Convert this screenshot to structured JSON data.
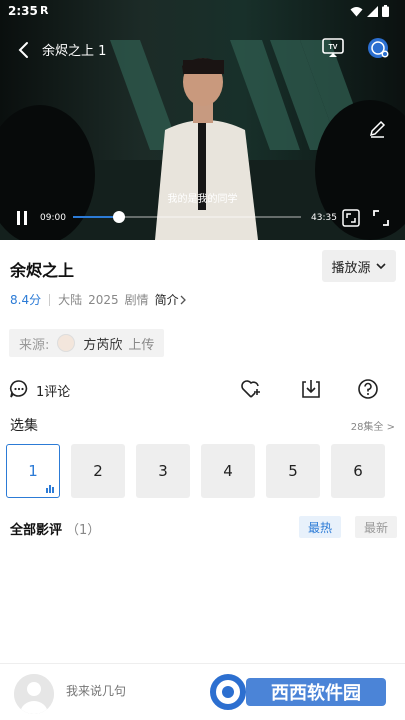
{
  "status_bar": {
    "time": "2:35",
    "sim": "R"
  },
  "player": {
    "title": "余烬之上 1",
    "subtitle": "我的是我的同学",
    "current_time": "09:00",
    "duration": "43:35",
    "progress": 0.2,
    "accent": "#2c7bd6"
  },
  "show": {
    "title": "余烬之上",
    "source_button": "播放源",
    "score": "8.4分",
    "region": "大陆",
    "year": "2025",
    "genre": "剧情",
    "intro": "简介",
    "source_label": "来源:",
    "uploader": "方芮欣",
    "uploader_action": "上传"
  },
  "actions": {
    "comments": "1评论"
  },
  "episodes": {
    "header": "选集",
    "all_label": "28集全 >",
    "items": [
      "1",
      "2",
      "3",
      "4",
      "5",
      "6"
    ],
    "active": 0
  },
  "reviews": {
    "header": "全部影评",
    "count": "（1）",
    "tab_hot": "最热",
    "tab_new": "最新"
  },
  "footer": {
    "placeholder": "我来说几句",
    "watermark": "西西软件园"
  },
  "icons": [
    "back-icon",
    "tv-cast-icon",
    "app-logo-icon",
    "edit-icon",
    "pause-icon",
    "screenshot-icon",
    "fullscreen-icon",
    "comment-icon",
    "favorite-add-icon",
    "download-icon",
    "help-icon",
    "chevron-down-icon",
    "chevron-right-icon",
    "user-avatar-icon",
    "wifi-icon",
    "signal-icon",
    "battery-icon"
  ]
}
